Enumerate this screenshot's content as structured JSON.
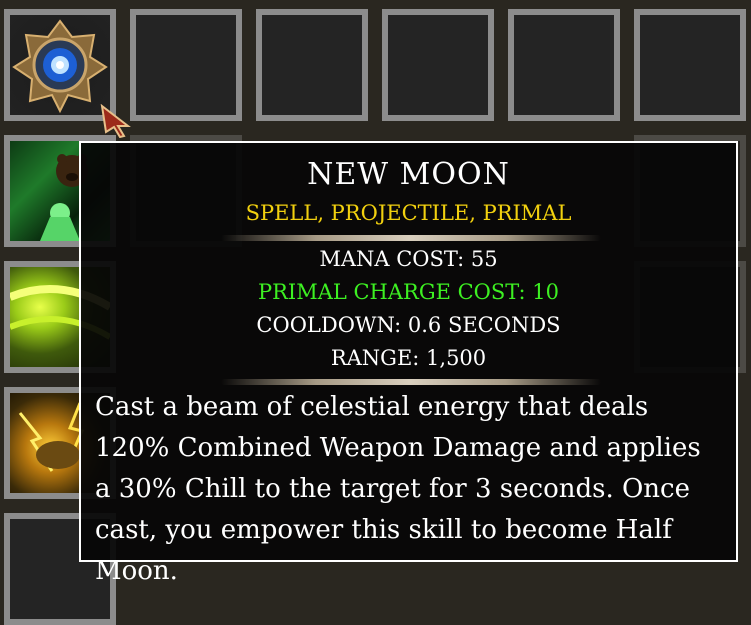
{
  "tooltip": {
    "title": "NEW MOON",
    "tags": "SPELL, PROJECTILE, PRIMAL",
    "stats": [
      {
        "label": "MANA COST: 55",
        "color": "#ffffff"
      },
      {
        "label": "PRIMAL CHARGE COST: 10",
        "color": "#3df022"
      },
      {
        "label": "COOLDOWN: 0.6 SECONDS",
        "color": "#ffffff"
      },
      {
        "label": "RANGE: 1,500",
        "color": "#ffffff"
      }
    ],
    "description": "Cast a beam of celestial energy that deals 120% Combined Weapon Damage and applies a 30% Chill to the target for 3 seconds. Once cast, you empower this skill to become Half Moon."
  },
  "slots": [
    {
      "icon": "moon-emblem-icon",
      "filled": true
    },
    {
      "icon": "empty-slot",
      "filled": false
    },
    {
      "icon": "empty-slot",
      "filled": false
    },
    {
      "icon": "empty-slot",
      "filled": false
    },
    {
      "icon": "empty-slot",
      "filled": false
    },
    {
      "icon": "empty-slot",
      "filled": false
    },
    {
      "icon": "druid-bear-icon",
      "filled": true
    },
    {
      "icon": "green-swirl-icon",
      "filled": true
    },
    {
      "icon": "lightning-beast-icon",
      "filled": true
    }
  ],
  "cursor": {
    "icon": "arrow-cursor-icon"
  }
}
